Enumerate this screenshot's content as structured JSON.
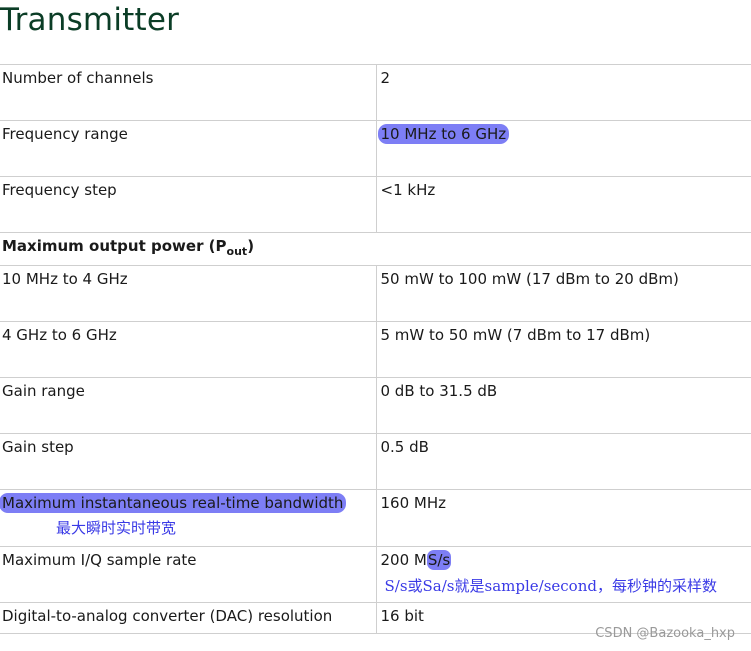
{
  "title": "Transmitter",
  "rows": [
    {
      "label": "Number of channels",
      "value": "2"
    },
    {
      "label": "Frequency range",
      "value": "10 MHz to 6 GHz"
    },
    {
      "label": "Frequency step",
      "value": "<1 kHz"
    },
    {
      "label": "Maximum output power (P",
      "label_sub": "out",
      "label_end": ")"
    },
    {
      "label": "10 MHz to 4 GHz",
      "value": "50 mW to 100 mW (17 dBm to 20 dBm)"
    },
    {
      "label": "4 GHz to 6 GHz",
      "value": "5 mW to 50 mW (7 dBm to 17 dBm)"
    },
    {
      "label": "Gain range",
      "value": "0 dB to 31.5 dB"
    },
    {
      "label": "Gain step",
      "value": "0.5 dB"
    },
    {
      "label": "Maximum instantaneous real-time bandwidth",
      "value": "160 MHz",
      "note": "最大瞬时实时带宽"
    },
    {
      "label": "Maximum I/Q sample rate",
      "value_prefix": "200 M",
      "value_highlight": "S/s",
      "note": "S/s或Sa/s就是sample/second，每秒钟的采样数"
    },
    {
      "label": "Digital-to-analog converter (DAC) resolution",
      "value": "16 bit"
    }
  ],
  "watermark": "CSDN @Bazooka_hxp",
  "colors": {
    "title": "#0b3d26",
    "highlight": "#7d7ef5",
    "annotation": "#3a3ae6",
    "border": "#cfcfcf"
  }
}
